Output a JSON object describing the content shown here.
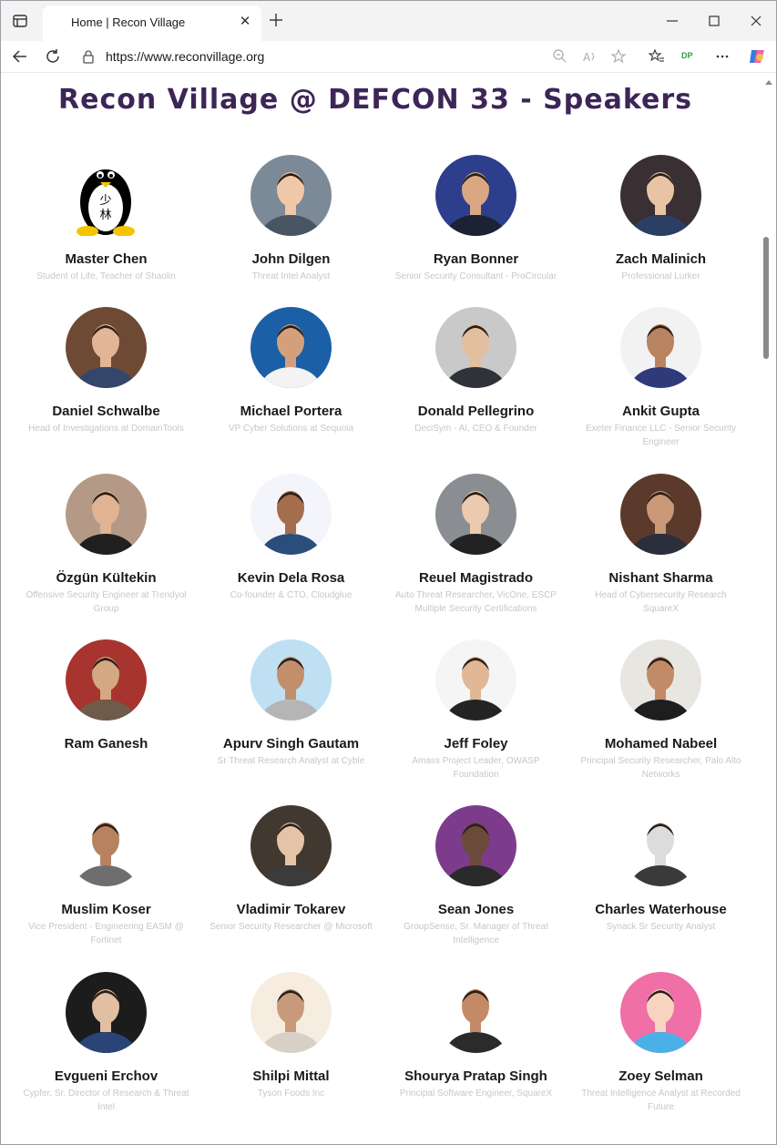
{
  "browser": {
    "tab_title": "Home | Recon Village",
    "tab_close_icon": "close-icon",
    "url": "https://www.reconvillage.org",
    "profile_badge": "DP"
  },
  "page": {
    "title": "Recon Village @ DEFCON 33 - Speakers",
    "title_color": "#3d2557"
  },
  "speakers": [
    {
      "name": "Master Chen",
      "role": "Student of Life, Teacher of Shaolin",
      "avatar": "penguin"
    },
    {
      "name": "John Dilgen",
      "role": "Threat Intel Analyst",
      "avatar": "photo"
    },
    {
      "name": "Ryan Bonner",
      "role": "Senior Security Consultant - ProCircular",
      "avatar": "photo"
    },
    {
      "name": "Zach Malinich",
      "role": "Professional Lurker",
      "avatar": "photo"
    },
    {
      "name": "Daniel Schwalbe",
      "role": "Head of Investigations at DomainTools",
      "avatar": "photo"
    },
    {
      "name": "Michael Portera",
      "role": "VP Cyber Solutions at Sequoia",
      "avatar": "photo"
    },
    {
      "name": "Donald Pellegrino",
      "role": "DeciSym - AI, CEO & Founder",
      "avatar": "photo"
    },
    {
      "name": "Ankit Gupta",
      "role": "Exeter Finance LLC - Senior Security Engineer",
      "avatar": "photo"
    },
    {
      "name": "Özgün Kültekin",
      "role": "Offensive Security Engineer at Trendyol Group",
      "avatar": "photo"
    },
    {
      "name": "Kevin Dela Rosa",
      "role": "Co-founder & CTO, Cloudglue",
      "avatar": "photo"
    },
    {
      "name": "Reuel Magistrado",
      "role": "Auto Threat Researcher, VicOne, ESCP Multiple Security Certifications",
      "avatar": "photo"
    },
    {
      "name": "Nishant Sharma",
      "role": "Head of Cybersecurity Research SquareX",
      "avatar": "photo"
    },
    {
      "name": "Ram Ganesh",
      "role": "",
      "avatar": "photo"
    },
    {
      "name": "Apurv Singh Gautam",
      "role": "Sr Threat Research Analyst at Cyble",
      "avatar": "photo"
    },
    {
      "name": "Jeff Foley",
      "role": "Amass Project Leader, OWASP Foundation",
      "avatar": "photo"
    },
    {
      "name": "Mohamed Nabeel",
      "role": "Principal Security Researcher, Palo Alto Networks",
      "avatar": "photo"
    },
    {
      "name": "Muslim Koser",
      "role": "Vice President - Engineering EASM @ Fortinet",
      "avatar": "photo"
    },
    {
      "name": "Vladimir Tokarev",
      "role": "Senior Security Researcher @ Microsoft",
      "avatar": "photo"
    },
    {
      "name": "Sean Jones",
      "role": "GroupSense, Sr. Manager of Threat Intelligence",
      "avatar": "photo"
    },
    {
      "name": "Charles Waterhouse",
      "role": "Synack Sr Security Analyst",
      "avatar": "photo"
    },
    {
      "name": "Evgueni Erchov",
      "role": "Cypfer, Sr. Director of Research & Threat Intel",
      "avatar": "photo"
    },
    {
      "name": "Shilpi Mittal",
      "role": "Tyson Foods Inc",
      "avatar": "photo"
    },
    {
      "name": "Shourya Pratap Singh",
      "role": "Principal Software Engineer, SquareX",
      "avatar": "photo"
    },
    {
      "name": "Zoey Selman",
      "role": "Threat Intelligence Analyst at Recorded Future",
      "avatar": "photo"
    }
  ]
}
